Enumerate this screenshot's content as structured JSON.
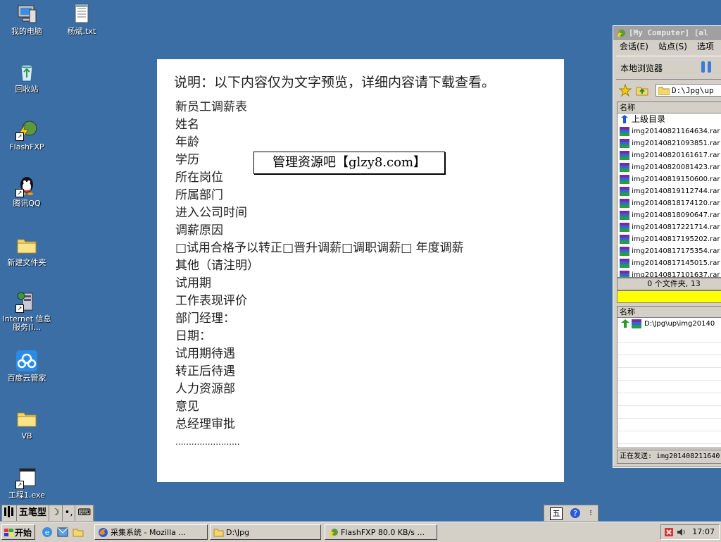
{
  "desktop": {
    "icons": [
      {
        "label": "我的电脑",
        "icon": "my-computer-icon"
      },
      {
        "label": "杨斌.txt",
        "icon": "text-file-icon"
      },
      {
        "label": "回收站",
        "icon": "recycle-bin-icon"
      },
      {
        "label": "FlashFXP",
        "icon": "flashfxp-icon"
      },
      {
        "label": "腾讯QQ",
        "icon": "qq-icon"
      },
      {
        "label": "新建文件夹",
        "icon": "folder-icon"
      },
      {
        "label": "Internet 信息服务(I...",
        "icon": "iis-icon"
      },
      {
        "label": "百度云管家",
        "icon": "baidu-cloud-icon"
      },
      {
        "label": "VB",
        "icon": "folder-icon"
      },
      {
        "label": "工程1.exe",
        "icon": "exe-icon"
      }
    ]
  },
  "preview": {
    "heading": "说明：以下内容仅为文字预览，详细内容请下载查看。",
    "lines": [
      "新员工调薪表",
      "姓名",
      "年龄",
      "学历",
      "所在岗位",
      "所属部门",
      "进入公司时间",
      "调薪原因",
      "□试用合格予以转正□晋升调薪□调职调薪□ 年度调薪",
      "其他（请注明）",
      "试用期",
      "工作表现评价",
      "部门经理：",
      "日期：",
      "试用期待遇",
      "转正后待遇",
      "人力资源部",
      "意见",
      "总经理审批"
    ],
    "dots": "........................",
    "watermark": "管理资源吧【glzy8.com】"
  },
  "ftp": {
    "title": "[My Computer]  [al",
    "menu": [
      "会话(E)",
      "站点(S)",
      "选项"
    ],
    "local_browser": "本地浏览器",
    "path": "D:\\Jpg\\up",
    "column_name": "名称",
    "parent_dir": "上级目录",
    "files": [
      "img20140821164634.rar",
      "img20140821093851.rar",
      "img20140820161617.rar",
      "img20140820081423.rar",
      "img20140819150600.rar",
      "img20140819112744.rar",
      "img20140818174120.rar",
      "img20140818090647.rar",
      "img20140817221714.rar",
      "img20140817195202.rar",
      "img20140817175354.rar",
      "img20140817145015.rar",
      "img20140817101637.rar"
    ],
    "status": "0 个文件夹, 13",
    "queue_column": "名称",
    "queue_item": "D:\\Jpg\\up\\img20140",
    "sending": "正在发送: img201408211640"
  },
  "ime": {
    "mode": "五笔型",
    "moon": "☽",
    "punct": "•,",
    "keyboard": "⌨"
  },
  "taskbar": {
    "start": "开始",
    "tasks": [
      {
        "label": "采集系统 - Mozilla ..."
      },
      {
        "label": "D:\\Jpg"
      },
      {
        "label": "FlashFXP 80.0 KB/s ..."
      }
    ],
    "clock": "17:07"
  },
  "colors": {
    "desktop": "#3a6ea5",
    "progress": "#ffff00"
  }
}
